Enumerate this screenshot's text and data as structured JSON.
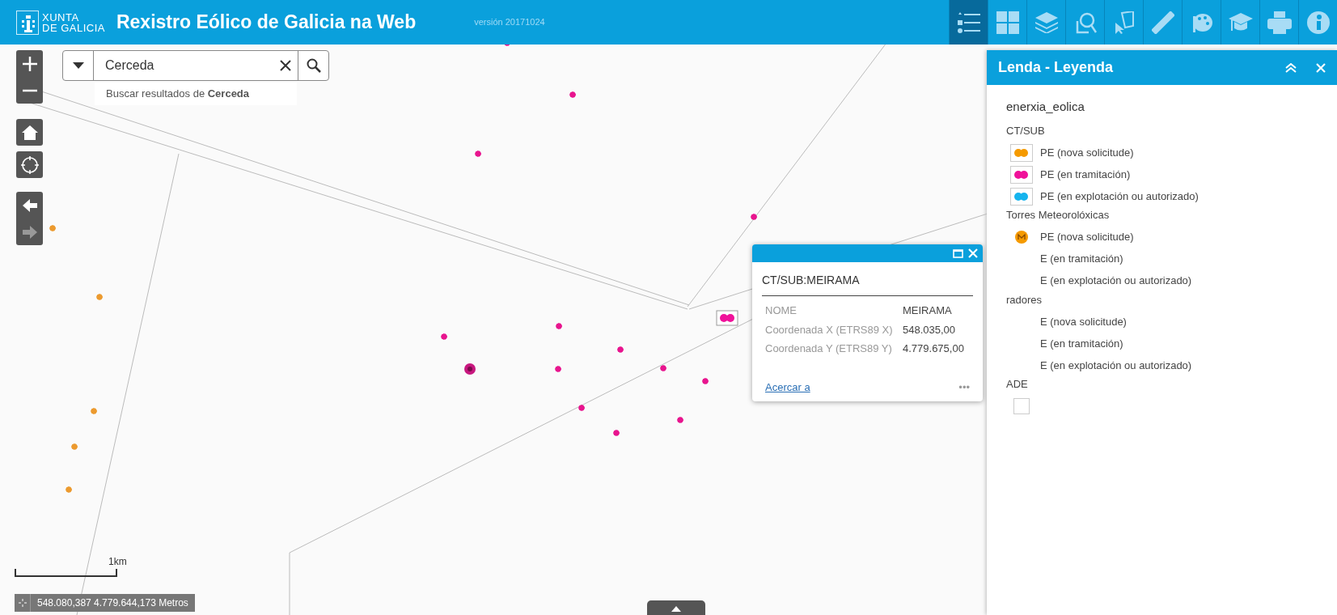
{
  "header": {
    "logo_lines": [
      "XUNTA",
      "DE GALICIA"
    ],
    "title": "Rexistro Eólico de Galicia na Web",
    "version": "versión 20171024",
    "tools": [
      {
        "selected": true
      },
      {
        "selected": false
      },
      {
        "selected": false
      },
      {
        "selected": false
      },
      {
        "selected": false
      },
      {
        "selected": false
      },
      {
        "selected": false
      },
      {
        "selected": false
      },
      {
        "selected": false
      },
      {
        "selected": false
      }
    ]
  },
  "search": {
    "value": "Cerceda",
    "hint": "Buscar resultados de **Cerceda**"
  },
  "navigation": {
    "back_disabled": false,
    "forward_disabled": true
  },
  "popup": {
    "title": "CT/SUB:MEIRAMA",
    "rows": [
      {
        "label": "NOME",
        "value": "MEIRAMA"
      },
      {
        "label": "Coordenada X (ETRS89 X)",
        "value": "548.035,00"
      },
      {
        "label": "Coordenada Y (ETRS89 Y)",
        "value": "4.779.675,00"
      }
    ],
    "link": "Acercar a",
    "more": "•••"
  },
  "legend": {
    "title": "Lenda - Leyenda",
    "layer": "enerxia_eolica",
    "groups": [
      {
        "heading": "CT/SUB",
        "items": [
          {
            "kind": "substation",
            "color": "#f59a00",
            "label": "PE (nova solicitude)"
          },
          {
            "kind": "substation",
            "color": "#f0129a",
            "label": "PE (en tramitación)"
          },
          {
            "kind": "substation",
            "color": "#15b4ee",
            "label": "PE (en explotación ou autorizado)"
          }
        ]
      },
      {
        "heading": "Torres Meteorolóxicas",
        "items": [
          {
            "kind": "tower",
            "color": "#f59a00",
            "label": "PE (nova solicitude)"
          },
          {
            "kind": "blank",
            "label": "E (en tramitación)"
          },
          {
            "kind": "blank",
            "label": "E (en explotación ou autorizado)"
          }
        ]
      },
      {
        "heading": "radores",
        "items": [
          {
            "kind": "blank",
            "label": "E (nova solicitude)"
          },
          {
            "kind": "blank",
            "label": "E (en tramitación)"
          },
          {
            "kind": "blank",
            "label": "E (en explotación ou autorizado)"
          }
        ]
      },
      {
        "heading": "ADE",
        "items": [
          {
            "kind": "empty-square"
          }
        ]
      }
    ]
  },
  "scale": "1km",
  "coordinates": "548.080,387 4.779.644,173 Metros"
}
